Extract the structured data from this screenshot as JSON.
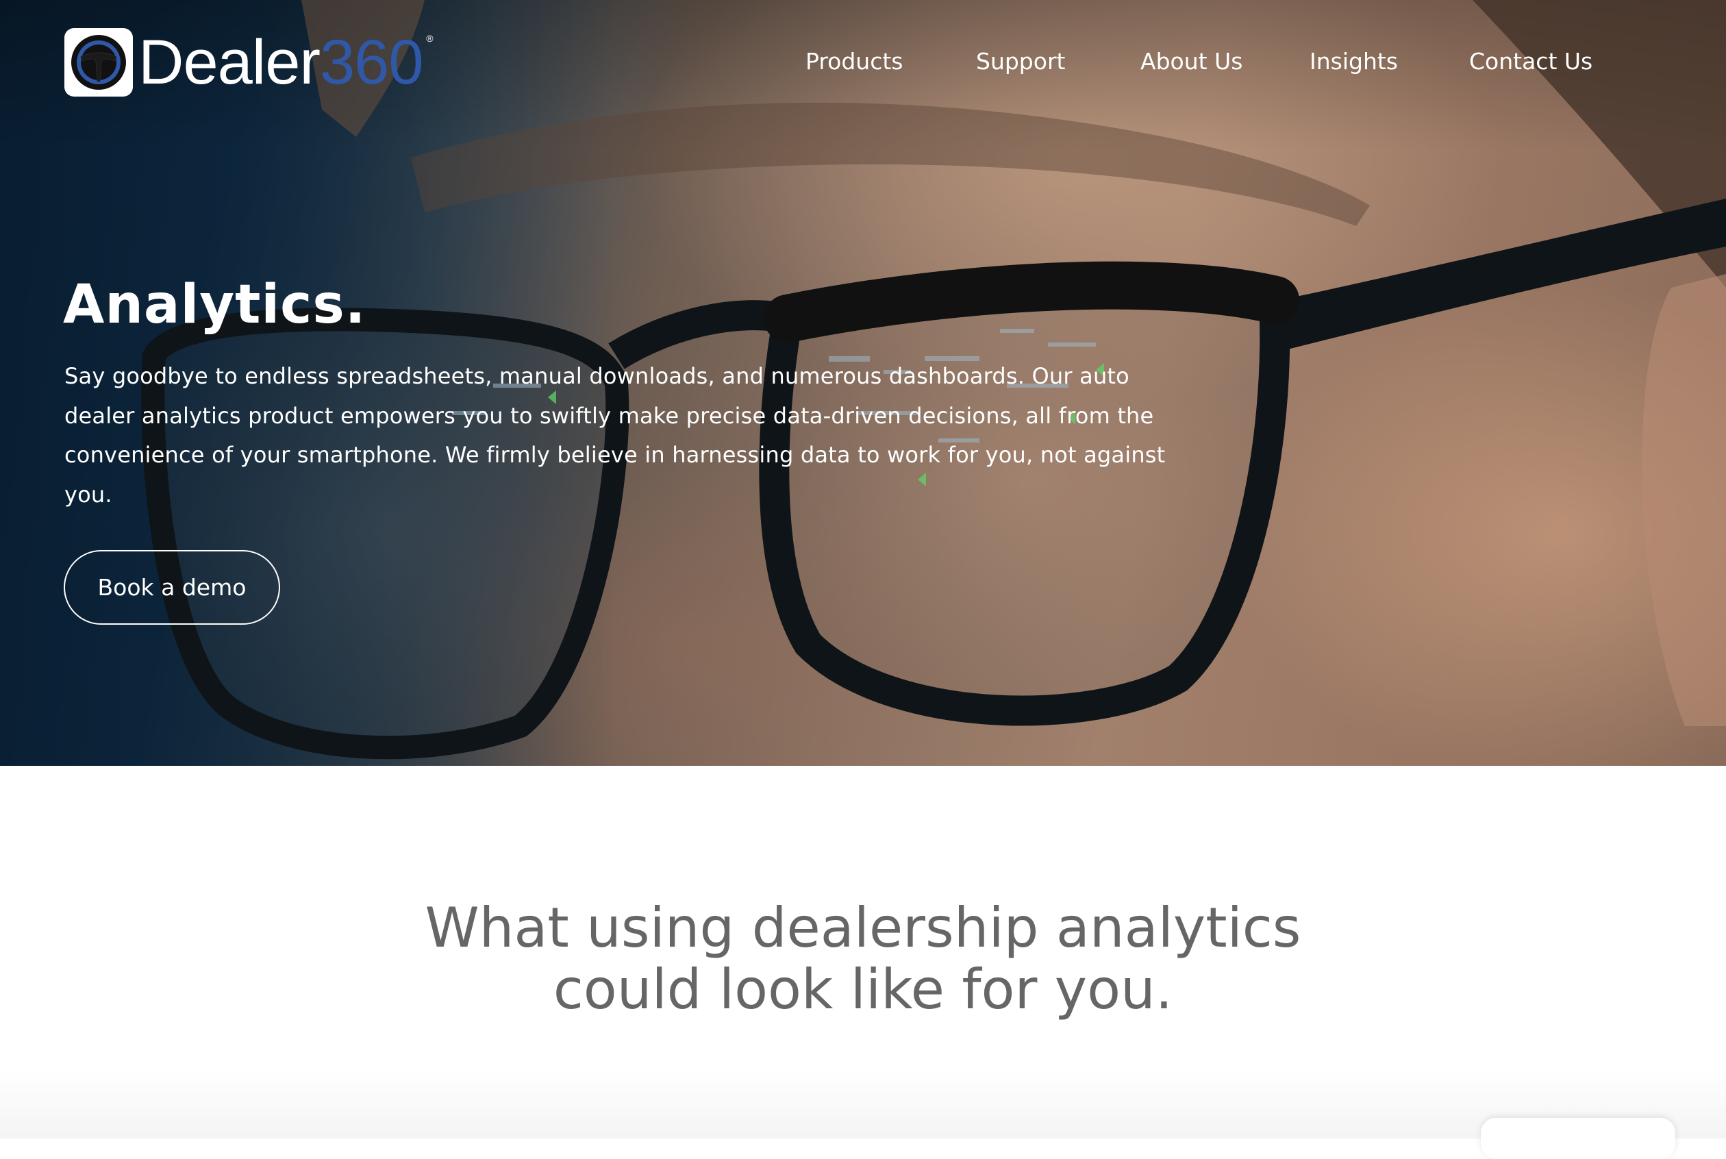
{
  "brand": {
    "name_word": "Dealer",
    "name_number": "360",
    "registered_mark": "®",
    "accent_color": "#2f58a8"
  },
  "nav": {
    "items": [
      {
        "label": "Products"
      },
      {
        "label": "Support"
      },
      {
        "label": "About Us"
      },
      {
        "label": "Insights"
      },
      {
        "label": "Contact Us"
      }
    ]
  },
  "hero": {
    "title": "Analytics.",
    "description": "Say goodbye to endless spreadsheets, manual downloads, and numerous dashboards. Our auto dealer analytics product empowers you to swiftly make precise data-driven decisions, all from the convenience of your smartphone. We firmly believe in harnessing data to work for you, not against you.",
    "cta_label": "Book a demo"
  },
  "section": {
    "heading_line1": "What using dealership analytics",
    "heading_line2": "could look like for you."
  },
  "colors": {
    "heading_gray": "#666666",
    "hero_dark": "#0b2236"
  }
}
